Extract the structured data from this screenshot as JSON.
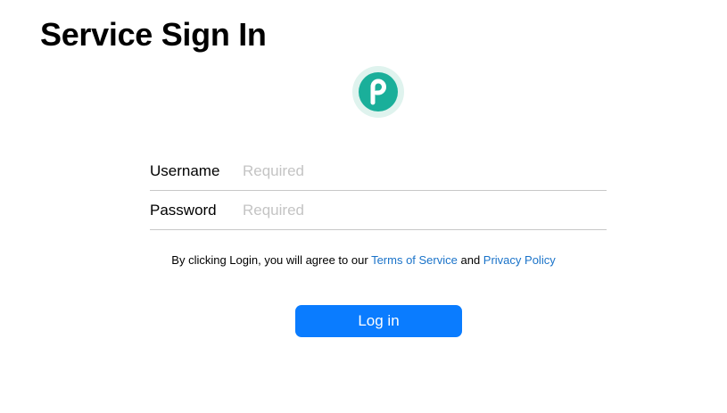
{
  "page": {
    "title": "Service Sign In"
  },
  "logo": {
    "icon": "p-logo-icon",
    "color": "#1aaf9a",
    "halo": "#dff3ee"
  },
  "form": {
    "username_label": "Username",
    "username_placeholder": "Required",
    "username_value": "",
    "password_label": "Password",
    "password_placeholder": "Required",
    "password_value": ""
  },
  "terms": {
    "prefix": "By clicking Login, you will agree to our ",
    "terms_link": "Terms of Service",
    "middle": " and ",
    "privacy_link": "Privacy Policy"
  },
  "login_button": {
    "label": "Log in",
    "color": "#0a7cff"
  }
}
